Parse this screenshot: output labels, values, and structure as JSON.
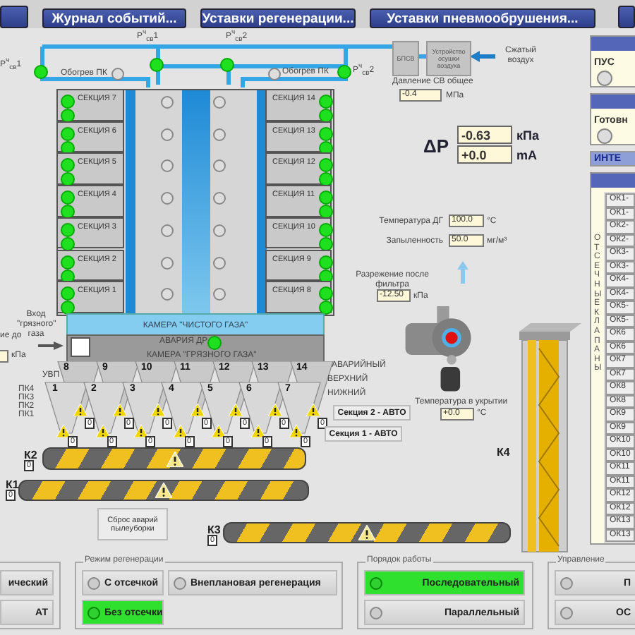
{
  "menu_buttons": [
    "Журнал событий...",
    "Уставки регенерации...",
    "Уставки пневмообрушения..."
  ],
  "air_supply": {
    "sensors": [
      "P$^{ч}$$_{св}$1",
      "P$^{ч}$$_{св}$1",
      "P$^{ч}$$_{св}$2",
      "P$^{ч}$$_{св}$2"
    ],
    "heating": [
      {
        "label": "Обогрев ПК",
        "on": false
      },
      {
        "label": "Обогрев ПК",
        "on": false
      }
    ],
    "bpsv": "БПСВ",
    "dryer": "Устройство осушки воздуха",
    "air_label": "Сжатый воздух",
    "pressure": {
      "label": "Давление СВ общее",
      "value": "-0.4",
      "unit": "МПа"
    }
  },
  "sections_left": [
    {
      "label": "СЕКЦИЯ 7",
      "upper_on": true,
      "lower_on": true
    },
    {
      "label": "СЕКЦИЯ 6",
      "upper_on": true,
      "lower_on": true
    },
    {
      "label": "СЕКЦИЯ 5",
      "upper_on": true,
      "lower_on": true
    },
    {
      "label": "СЕКЦИЯ 4",
      "upper_on": true,
      "lower_on": true
    },
    {
      "label": "СЕКЦИЯ 3",
      "upper_on": true,
      "lower_on": true
    },
    {
      "label": "СЕКЦИЯ 2",
      "upper_on": true,
      "lower_on": true
    },
    {
      "label": "СЕКЦИЯ 1",
      "upper_on": true,
      "lower_on": true
    }
  ],
  "sections_right": [
    {
      "label": "СЕКЦИЯ 14",
      "upper_on": true,
      "lower_on": true
    },
    {
      "label": "СЕКЦИЯ 13",
      "upper_on": true,
      "lower_on": true
    },
    {
      "label": "СЕКЦИЯ 12",
      "upper_on": true,
      "lower_on": true
    },
    {
      "label": "СЕКЦИЯ 11",
      "upper_on": true,
      "lower_on": true
    },
    {
      "label": "СЕКЦИЯ 10",
      "upper_on": true,
      "lower_on": true
    },
    {
      "label": "СЕКЦИЯ 9",
      "upper_on": true,
      "lower_on": true
    },
    {
      "label": "СЕКЦИЯ 8",
      "upper_on": true,
      "lower_on": true
    }
  ],
  "clean_chamber": "КАМЕРА \"ЧИСТОГО ГАЗА\"",
  "dirty_chamber": {
    "label": "КАМЕРА \"ГРЯЗНОГО ГАЗА\"",
    "alarm_label": "АВАРИЯ ДР",
    "alarm_on": true
  },
  "inlet_label": "Вход \"грязного\" газа",
  "vacuum_before": {
    "label": "ие до",
    "unit": "кПа"
  },
  "delta_p": {
    "symbol": "ΔP",
    "readings": [
      {
        "value": "-0.63",
        "unit": "кПа"
      },
      {
        "value": "+0.0",
        "unit": "mA"
      }
    ]
  },
  "readings": [
    {
      "label": "Температура ДГ",
      "value": "100.0",
      "unit": "°С"
    },
    {
      "label": "Запыленность",
      "value": "50.0",
      "unit": "мг/м³"
    }
  ],
  "vacuum_after": {
    "label": "Разрежение после фильтра",
    "value": "-12.50",
    "unit": "кПа"
  },
  "hopper_labels": [
    "УВП",
    "ПК4",
    "ПК3",
    "ПК2",
    "ПК1"
  ],
  "hoppers": [
    {
      "number": "8",
      "counter": "0"
    },
    {
      "number": "9",
      "counter": "0"
    },
    {
      "number": "10",
      "counter": "0"
    },
    {
      "number": "11",
      "counter": "0"
    },
    {
      "number": "12",
      "counter": "0"
    },
    {
      "number": "13",
      "counter": "0"
    },
    {
      "number": "14",
      "counter": "0"
    },
    {
      "number": "1",
      "counter": "0"
    },
    {
      "number": "2",
      "counter": "0"
    },
    {
      "number": "3",
      "counter": "0"
    },
    {
      "number": "4",
      "counter": "0"
    },
    {
      "number": "5",
      "counter": "0"
    },
    {
      "number": "6",
      "counter": "0"
    },
    {
      "number": "7",
      "counter": "0"
    }
  ],
  "level_labels": [
    "АВАРИЙНЫЙ",
    "ВЕРХНИЙ",
    "НИЖНИЙ"
  ],
  "mode_buttons": [
    "Секция 2 - АВТО",
    "Секция 1 - АВТО"
  ],
  "shelter_temp": {
    "label": "Температура в укрытии",
    "value": "+0.0",
    "unit": "°С"
  },
  "conveyors": [
    {
      "name": "К2",
      "counter": "0"
    },
    {
      "name": "К1",
      "counter": "0"
    },
    {
      "name": "К3",
      "counter": "0"
    }
  ],
  "elevator": "К4",
  "reset_button": "Сброс аварий пылеуборки",
  "side_panels": [
    {
      "kind": "lamp",
      "label": "ПУС",
      "on": false
    },
    {
      "kind": "lamp",
      "label": "Готовн",
      "on": false
    },
    {
      "kind": "header",
      "label": "ИНТЕ"
    }
  ],
  "valves": {
    "title": "ОТСЕЧНЫЕ КЛАПАНЫ",
    "items": [
      "ОК1-",
      "ОК1-",
      "ОК2-",
      "ОК2-",
      "ОК3-",
      "ОК3-",
      "ОК4-",
      "ОК4-",
      "ОК5-",
      "ОК5-",
      "ОК6",
      "ОК6",
      "ОК7",
      "ОК7",
      "ОК8",
      "ОК8",
      "ОК9",
      "ОК9",
      "ОК10",
      "ОК10",
      "ОК11",
      "ОК11",
      "ОК12",
      "ОК12",
      "ОК13",
      "ОК13"
    ]
  },
  "bottom_groups": [
    {
      "kind": "plain",
      "options": [
        {
          "label": "ический",
          "selected": false
        },
        {
          "label": "АТ",
          "selected": false
        }
      ]
    },
    {
      "kind": "radio",
      "title": "Режим регенерации",
      "options": [
        {
          "label": "С отсечкой",
          "selected": false
        },
        {
          "label": "Внеплановая регенерация",
          "selected": false
        },
        {
          "label": "Без отсечки",
          "selected": true
        }
      ]
    },
    {
      "kind": "radio",
      "title": "Порядок работы",
      "options": [
        {
          "label": "Последовательный",
          "selected": true
        },
        {
          "label": "Параллельный",
          "selected": false
        }
      ]
    },
    {
      "kind": "radio",
      "title": "Управление",
      "options": [
        {
          "label": "П",
          "selected": false
        },
        {
          "label": "ОС",
          "selected": false
        }
      ]
    }
  ]
}
